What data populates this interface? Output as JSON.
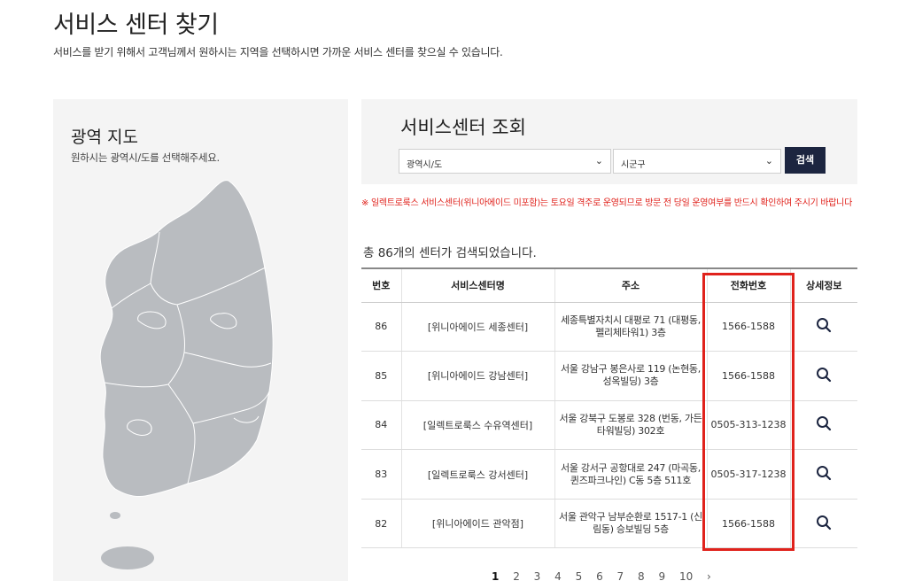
{
  "page": {
    "title": "서비스 센터 찾기",
    "subtitle": "서비스를 받기 위해서 고객님께서 원하시는 지역을 선택하시면 가까운 서비스 센터를 찾으실 수 있습니다."
  },
  "map_panel": {
    "title": "광역 지도",
    "subtitle": "원하시는 광역시/도를 선택해주세요."
  },
  "search": {
    "title": "서비스센터 조회",
    "region_select": "광역시/도",
    "district_select": "시군구",
    "search_button": "검색"
  },
  "notice": "※ 일렉트로룩스 서비스센터(위니아에이드 미포함)는 토요일 격주로 운영되므로 방문 전 당일 운영여부를 반드시 확인하여 주시기 바랍니다",
  "result_count": "총 86개의 센터가 검색되었습니다.",
  "table": {
    "headers": [
      "번호",
      "서비스센터명",
      "주소",
      "전화번호",
      "상세정보"
    ],
    "rows": [
      {
        "no": "86",
        "name": "[위니아에이드 세종센터]",
        "addr1": "세종특별자치시 대평로 71 (대평동,",
        "addr2": "펠리체타워1) 3층",
        "phone": "1566-1588"
      },
      {
        "no": "85",
        "name": "[위니아에이드 강남센터]",
        "addr1": "서울 강남구 봉은사로 119 (논현동,",
        "addr2": "성옥빌딩) 3층",
        "phone": "1566-1588"
      },
      {
        "no": "84",
        "name": "[일렉트로룩스 수유역센터]",
        "addr1": "서울 강북구 도봉로 328 (번동, 가든",
        "addr2": "타워빌딩) 302호",
        "phone": "0505-313-1238"
      },
      {
        "no": "83",
        "name": "[일렉트로룩스 강서센터]",
        "addr1": "서울 강서구 공항대로 247 (마곡동,",
        "addr2": "퀸즈파크나인) C동 5층 511호",
        "phone": "0505-317-1238"
      },
      {
        "no": "82",
        "name": "[위니아에이드 관악점]",
        "addr1": "서울 관악구 남부순환로 1517-1 (신",
        "addr2": "림동) 승보빌딩 5층",
        "phone": "1566-1588"
      }
    ]
  },
  "pagination": {
    "pages": [
      "1",
      "2",
      "3",
      "4",
      "5",
      "6",
      "7",
      "8",
      "9",
      "10"
    ],
    "current": "1",
    "next": "›"
  },
  "colors": {
    "accent_button": "#1c2540",
    "notice_red": "#e0221c",
    "panel_bg": "#f4f4f4",
    "map_gray": "#b9bcc0"
  },
  "icons": {
    "detail": "search-icon",
    "select": "chevron-down-icon"
  }
}
